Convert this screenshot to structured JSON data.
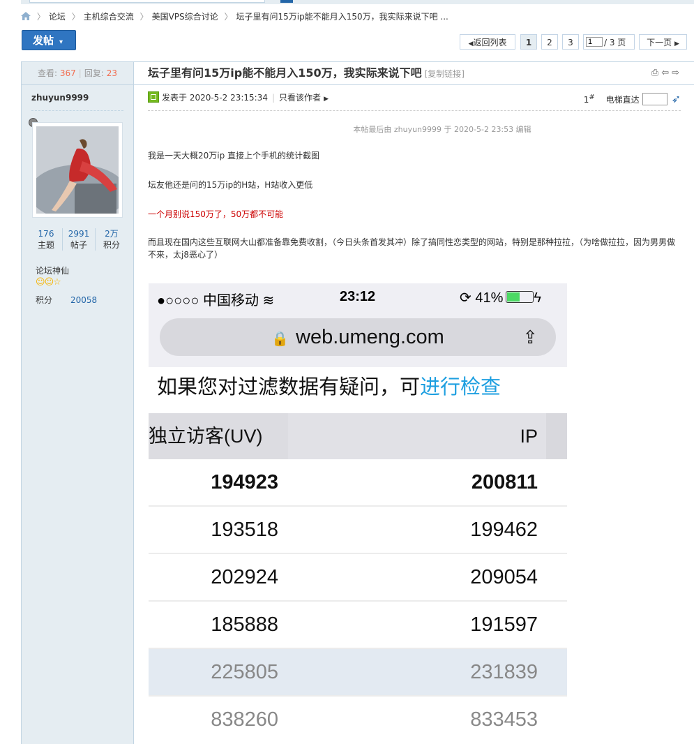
{
  "breadcrumb": {
    "items": [
      "论坛",
      "主机综合交流",
      "美国VPS综合讨论",
      "坛子里有问15万ip能不能月入150万，我实际来说下吧 ..."
    ]
  },
  "toolbar": {
    "post_button": "发帖",
    "back_to_list": "返回列表",
    "pages": [
      "1",
      "2",
      "3"
    ],
    "page_input": "1",
    "page_total": "/ 3 页",
    "next_page": "下一页"
  },
  "sidebar": {
    "views_label": "查看:",
    "views": "367",
    "replies_label": "回复:",
    "replies": "23",
    "author": "zhuyun9999",
    "stats": [
      {
        "value": "176",
        "label": "主题"
      },
      {
        "value": "2991",
        "label": "帖子"
      },
      {
        "value": "2万",
        "label": "积分"
      }
    ],
    "group": "论坛神仙",
    "score_label": "积分",
    "score_value": "20058"
  },
  "post": {
    "title": "坛子里有问15万ip能不能月入150万，我实际来说下吧",
    "copy_link": "[复制链接]",
    "posted_at": "发表于 2020-5-2 23:15:34",
    "only_author": "只看该作者",
    "floor": "1",
    "floor_sup": "#",
    "elevator_label": "电梯直达",
    "edit_note": "本帖最后由 zhuyun9999 于 2020-5-2 23:53 编辑",
    "paragraphs": [
      "我是一天大概20万ip   直接上个手机的统计截图",
      "坛友他还是问的15万ip的H站，H站收入更低",
      "一个月别说150万了，50万都不可能",
      "而且现在国内这些互联网大山都准备靠免费收割，（今日头条首发其冲）除了搞同性恋类型的网站，特别是那种拉拉，（为啥做拉拉，因为男男做不来，太j8恶心了）"
    ],
    "highlight_color": "#cc0000"
  },
  "screenshot": {
    "carrier": "●○○○○ 中国移动",
    "time": "23:12",
    "battery": "41%",
    "url": "web.umeng.com",
    "note_prefix": "如果您对过滤数据有疑问，可",
    "note_link": "进行检查",
    "col1_header": "独立访客(UV)",
    "col2_header": "IP",
    "rows": [
      {
        "uv": "194923",
        "ip": "200811"
      },
      {
        "uv": "193518",
        "ip": "199462"
      },
      {
        "uv": "202924",
        "ip": "209054"
      },
      {
        "uv": "185888",
        "ip": "191597"
      },
      {
        "uv": "225805",
        "ip": "231839"
      },
      {
        "uv": "838260",
        "ip": "833453"
      }
    ]
  }
}
